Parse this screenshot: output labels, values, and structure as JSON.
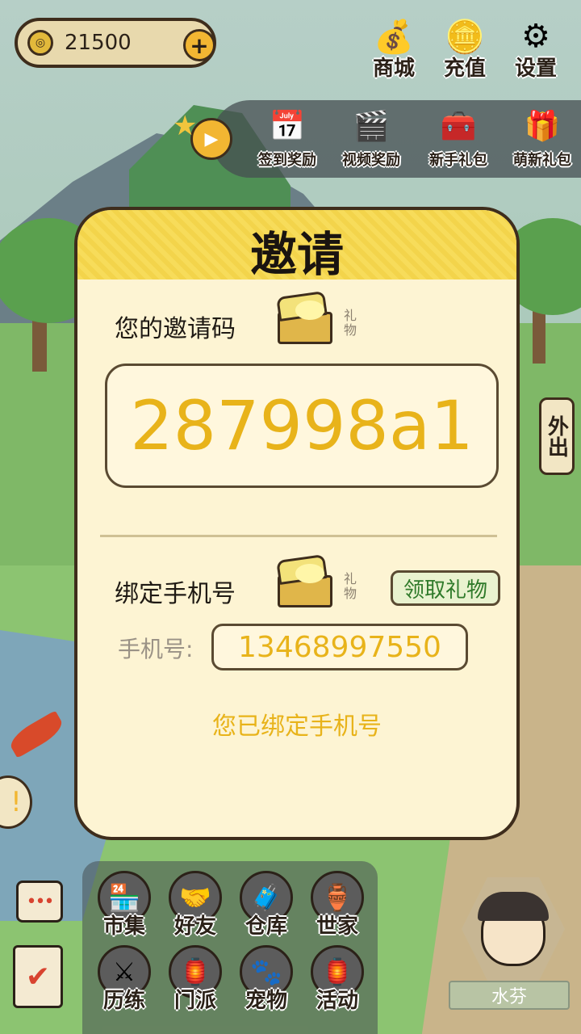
{
  "currency": {
    "amount": "21500",
    "coin_glyph": "◎",
    "plus_label": "+"
  },
  "top_buttons": [
    {
      "label": "商城",
      "icon": "money-bag-icon",
      "glyph": "💰"
    },
    {
      "label": "充值",
      "icon": "gold-ingot-icon",
      "glyph": "🪙"
    },
    {
      "label": "设置",
      "icon": "gear-icon",
      "glyph": "⚙"
    }
  ],
  "rewards": {
    "star_glyph": "★",
    "play_glyph": "▶",
    "items": [
      {
        "label": "签到奖励",
        "icon": "calendar-icon",
        "glyph": "📅"
      },
      {
        "label": "视频奖励",
        "icon": "clapperboard-icon",
        "glyph": "🎬"
      },
      {
        "label": "新手礼包",
        "icon": "chest-icon",
        "glyph": "🧰"
      },
      {
        "label": "萌新礼包",
        "icon": "newbie-gift-icon",
        "glyph": "🎁"
      }
    ]
  },
  "side": {
    "out_label": "外出",
    "alert_glyph": "!"
  },
  "dialog": {
    "title": "邀请",
    "invite_label": "您的邀请码",
    "gift_label": "礼物",
    "invite_code": "287998a1",
    "bind_label": "绑定手机号",
    "claim_label": "领取礼物",
    "phone_label": "手机号:",
    "phone_value": "13468997550",
    "bound_status": "您已绑定手机号"
  },
  "menu": {
    "items": [
      {
        "label": "市集",
        "icon": "market-icon",
        "glyph": "🏪"
      },
      {
        "label": "好友",
        "icon": "handshake-icon",
        "glyph": "🤝"
      },
      {
        "label": "仓库",
        "icon": "storage-chest-icon",
        "glyph": "🧳"
      },
      {
        "label": "世家",
        "icon": "clan-cauldron-icon",
        "glyph": "🏺"
      },
      {
        "label": "历练",
        "icon": "crossed-swords-icon",
        "glyph": "⚔"
      },
      {
        "label": "门派",
        "icon": "sect-banner-icon",
        "glyph": "🏮"
      },
      {
        "label": "宠物",
        "icon": "paw-icon",
        "glyph": "🐾"
      },
      {
        "label": "活动",
        "icon": "lantern-icon",
        "glyph": "🏮"
      }
    ],
    "chat_glyph": "•••",
    "task_glyph": "✔"
  },
  "character": {
    "name": "水芬"
  },
  "colors": {
    "accent": "#e8b31a",
    "header": "#f7dc5a",
    "panel": "#fdf4d3",
    "outline": "#3e2d1c"
  }
}
